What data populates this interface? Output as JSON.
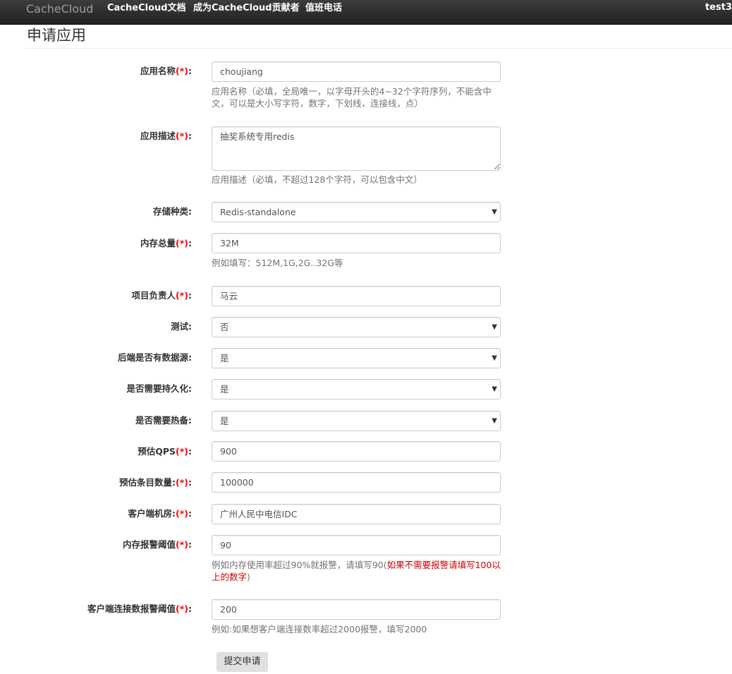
{
  "navbar": {
    "brand": "CacheCloud",
    "links": [
      "CacheCloud文档",
      "成为CacheCloud贡献者",
      "值班电话"
    ],
    "user": "test3"
  },
  "page_title": "申请应用",
  "required_mark": "(*)",
  "form": {
    "app_name": {
      "label": "应用名称",
      "value": "choujiang",
      "help": "应用名称（必填，全局唯一，以字母开头的4~32个字符序列，不能含中文，可以是大小写字符，数字，下划线，连接线，点）"
    },
    "app_desc": {
      "label": "应用描述",
      "value": "抽奖系统专用redis",
      "help": "应用描述（必填，不超过128个字符，可以包含中文）"
    },
    "storage_type": {
      "label": "存储种类:",
      "value": "Redis-standalone"
    },
    "memory_total": {
      "label": "内存总量",
      "value": "32M",
      "help": "例如填写：512M,1G,2G..32G等"
    },
    "owner": {
      "label": "项目负责人",
      "value": "马云"
    },
    "is_test": {
      "label": "测试:",
      "value": "否"
    },
    "has_datasource": {
      "label": "后端是否有数据源:",
      "value": "是"
    },
    "need_persistence": {
      "label": "是否需要持久化:",
      "value": "是"
    },
    "need_hot_backup": {
      "label": "是否需要热备:",
      "value": "是"
    },
    "qps": {
      "label": "预估QPS",
      "value": "900"
    },
    "item_count": {
      "label": "预估条目数量:",
      "value": "100000"
    },
    "client_idc": {
      "label": "客户端机房:",
      "value": "广州人民中电信IDC"
    },
    "mem_alarm": {
      "label": "内存报警阈值",
      "value": "90",
      "help_prefix": "例如内存使用率超过90%就报警，请填写90(",
      "help_red": "如果不需要报警请填写100以上的数字",
      "help_suffix": ")"
    },
    "client_conn_alarm": {
      "label": "客户端连接数报警阈值",
      "value": "200",
      "help": "例如:如果想客户端连接数率超过2000报警，填写2000"
    }
  },
  "submit_label": "提交申请",
  "colors": {
    "navbar": "#222222",
    "required": "#ff0000",
    "help_red": "#cc0000"
  }
}
